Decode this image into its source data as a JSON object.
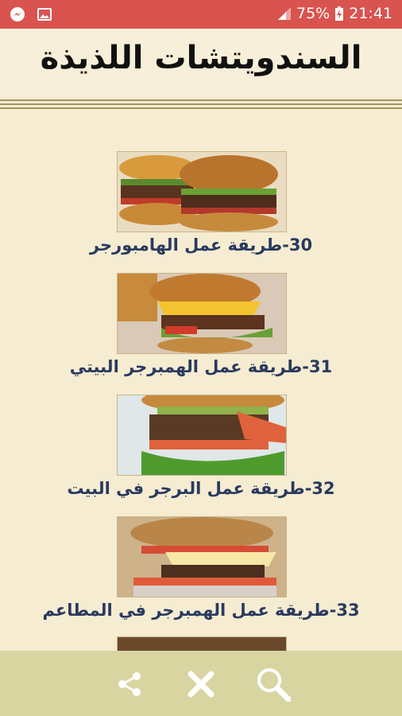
{
  "status_bar": {
    "battery_percent": "75%",
    "time": "21:41",
    "icons": [
      "messenger-icon",
      "image-icon",
      "signal-icon",
      "battery-charging-icon"
    ]
  },
  "header": {
    "title": "السندويتشات اللذيذة"
  },
  "items": [
    {
      "label": "30-طريقة عمل الهامبورجر",
      "image": "hamburger-photo"
    },
    {
      "label": "31-طريقة عمل الهمبرجر البيتي",
      "image": "cheeseburger-photo"
    },
    {
      "label": "32-طريقة عمل البرجر في البيت",
      "image": "burger-with-pickles-photo"
    },
    {
      "label": "33-طريقة عمل الهمبرجر في المطاعم",
      "image": "restaurant-burger-photo"
    }
  ],
  "bottom_bar": {
    "icons": [
      "share-icon",
      "close-icon",
      "search-icon"
    ]
  },
  "colors": {
    "status_bar": "#d9534f",
    "background": "#f5ecd1",
    "bottom_bar": "#d8d5a1",
    "label_text": "#2a3a5f"
  }
}
